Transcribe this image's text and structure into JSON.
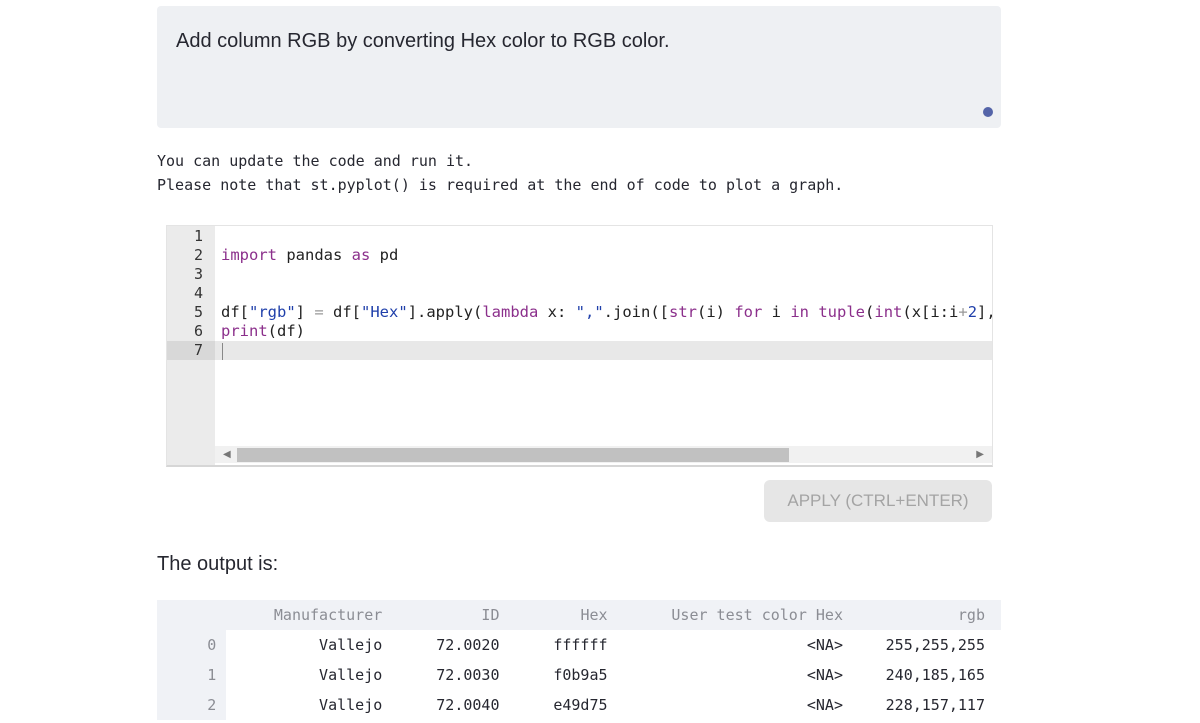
{
  "prompt": {
    "text": "Add column RGB by converting Hex color to RGB color."
  },
  "note": {
    "line1": "You can update the code and run it.",
    "line2": "Please note that st.pyplot() is required at the end of code to plot a graph."
  },
  "editor": {
    "line_numbers": [
      "1",
      "2",
      "3",
      "4",
      "5",
      "6",
      "7"
    ],
    "active_line": 7,
    "code": {
      "line2_kw_import": "import",
      "line2_mod": " pandas ",
      "line2_kw_as": "as",
      "line2_alias": " pd",
      "line5_a": "df[",
      "line5_s1": "\"rgb\"",
      "line5_b": "] ",
      "line5_eq": "=",
      "line5_c": " df[",
      "line5_s2": "\"Hex\"",
      "line5_d": "].apply(",
      "line5_kw_lambda": "lambda",
      "line5_e": " x: ",
      "line5_s3": "\",\"",
      "line5_f": ".join([",
      "line5_fn_str": "str",
      "line5_g": "(i) ",
      "line5_kw_for": "for",
      "line5_h": " i ",
      "line5_kw_in": "in",
      "line5_i": " ",
      "line5_fn_tuple": "tuple",
      "line5_j": "(",
      "line5_fn_int": "int",
      "line5_k": "(x[i:i",
      "line5_plus": "+",
      "line5_num": "2",
      "line5_l": "],",
      "line6_fn_print": "print",
      "line6_rest": "(df)"
    }
  },
  "apply_button": {
    "label": "APPLY (CTRL+ENTER)"
  },
  "output": {
    "label": "The output is:",
    "columns": [
      "",
      "Manufacturer",
      "ID",
      "Hex",
      "User test color Hex",
      "rgb"
    ],
    "rows": [
      [
        "0",
        "Vallejo",
        "72.0020",
        "ffffff",
        "<NA>",
        "255,255,255"
      ],
      [
        "1",
        "Vallejo",
        "72.0030",
        "f0b9a5",
        "<NA>",
        "240,185,165"
      ],
      [
        "2",
        "Vallejo",
        "72.0040",
        "e49d75",
        "<NA>",
        "228,157,117"
      ]
    ]
  },
  "colors": {
    "prompt_bg": "#eef0f3",
    "accent_dot": "#5464a8",
    "keyword": "#8b2f8b",
    "string": "#1f3faa",
    "table_header_bg": "#f0f2f6",
    "button_bg": "#e6e6e6"
  }
}
